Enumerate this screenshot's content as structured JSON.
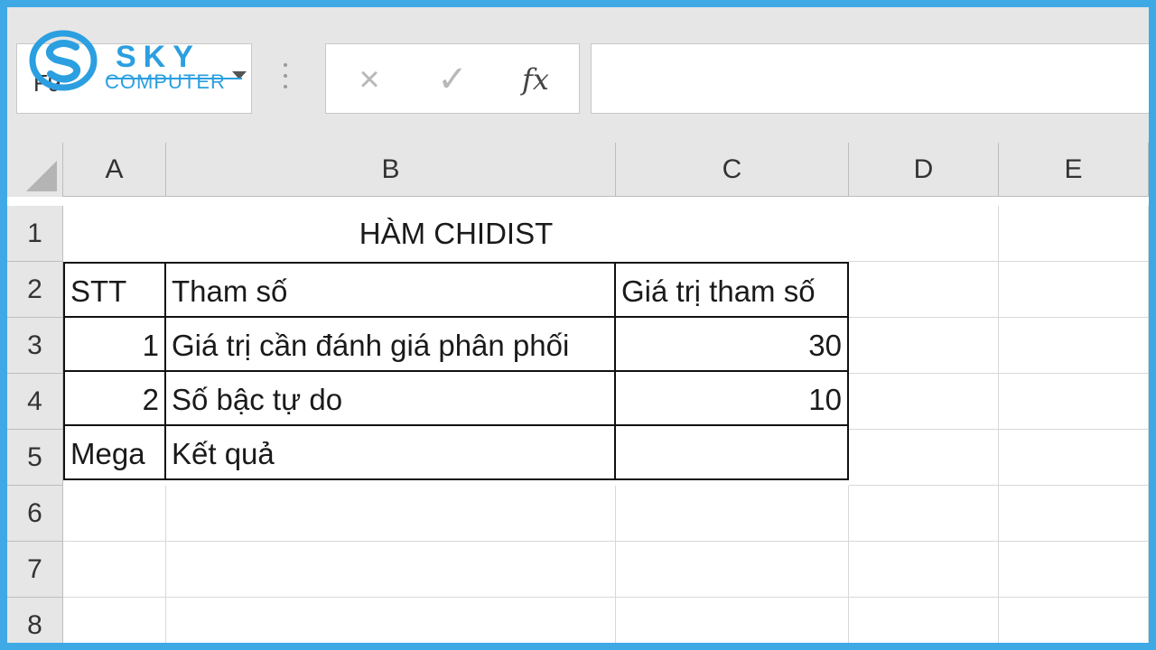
{
  "logo": {
    "brand_top": "SKY",
    "brand_bottom": "COMPUTER"
  },
  "name_box": {
    "value": "F9"
  },
  "formula_bar": {
    "cancel_icon": "×",
    "enter_icon": "✓",
    "function_icon": "fx",
    "value": ""
  },
  "columns": [
    "A",
    "B",
    "C",
    "D",
    "E"
  ],
  "rows": [
    "1",
    "2",
    "3",
    "4",
    "5",
    "6",
    "7",
    "8"
  ],
  "sheet": {
    "title": "HÀM CHIDIST",
    "header": {
      "stt": "STT",
      "param": "Tham số",
      "value": "Giá trị tham số"
    },
    "r3": {
      "stt": "1",
      "param": "Giá trị cần đánh giá phân phối",
      "value": "30"
    },
    "r4": {
      "stt": "2",
      "param": "Số bậc tự do",
      "value": "10"
    },
    "r5": {
      "stt": "Mega",
      "param": "Kết quả",
      "value": ""
    }
  },
  "colors": {
    "frame": "#3fa9e6",
    "brand": "#2b9fe0",
    "chrome": "#e6e6e6"
  }
}
